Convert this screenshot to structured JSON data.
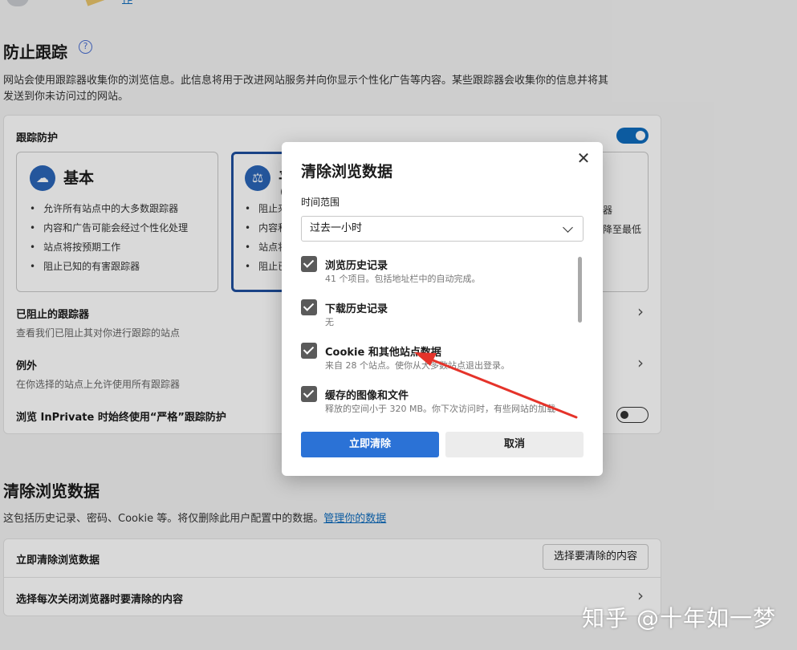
{
  "top": {
    "link_text": "作"
  },
  "tracking": {
    "title": "防止跟踪",
    "help_glyph": "?",
    "description_line1": "网站会使用跟踪器收集你的浏览信息。此信息将用于改进网站服务并向你显示个性化广告等内容。某些跟踪器会收集你的信息并将其",
    "description_line2": "发送到你未访问过的网站。",
    "protection_label": "跟踪防护",
    "modes": [
      {
        "name": "基本",
        "bullets": [
          "允许所有站点中的大多数跟踪器",
          "内容和广告可能会经过个性化处理",
          "站点将按预期工作",
          "阻止已知的有害跟踪器"
        ]
      },
      {
        "name": "平",
        "partial_top": "(",
        "bullets": [
          "阻止来",
          "内容和",
          "站点将",
          "阻止已"
        ]
      },
      {
        "bullets": [
          "器",
          "降至最低"
        ]
      }
    ],
    "blocked_title": "已阻止的跟踪器",
    "blocked_sub": "查看我们已阻止其对你进行跟踪的站点",
    "exceptions_title": "例外",
    "exceptions_sub": "在你选择的站点上允许使用所有跟踪器",
    "inprivate_label": "浏览 InPrivate 时始终使用“严格”跟踪防护"
  },
  "clear_section": {
    "title": "清除浏览数据",
    "description": "这包括历史记录、密码、Cookie 等。将仅删除此用户配置中的数据。",
    "manage_link": "管理你的数据",
    "clear_now_label": "立即清除浏览数据",
    "choose_button": "选择要清除的内容",
    "on_close_label": "选择每次关闭浏览器时要清除的内容"
  },
  "dialog": {
    "title": "清除浏览数据",
    "close_glyph": "✕",
    "time_range_label": "时间范围",
    "time_range_value": "过去一小时",
    "items": [
      {
        "title": "浏览历史记录",
        "sub": "41 个项目。包括地址栏中的自动完成。",
        "checked": true
      },
      {
        "title": "下载历史记录",
        "sub": "无",
        "checked": true
      },
      {
        "title": "Cookie 和其他站点数据",
        "sub": "来自 28 个站点。使你从大多数站点退出登录。",
        "checked": true
      },
      {
        "title": "缓存的图像和文件",
        "sub": "释放的空间小于 320 MB。你下次访问时，有些网站的加载",
        "checked": true
      }
    ],
    "clear_button": "立即清除",
    "cancel_button": "取消"
  },
  "watermark": "知乎 @十年如一梦",
  "colors": {
    "accent": "#0f6cbd",
    "primary_button": "#2b72d6",
    "annotation_arrow": "#e5332a"
  }
}
